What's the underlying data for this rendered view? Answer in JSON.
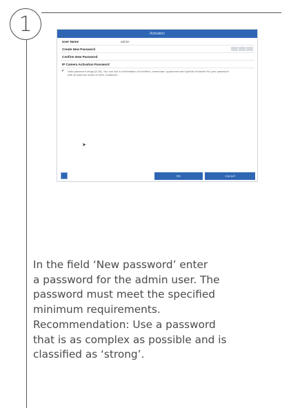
{
  "step": {
    "number": "1"
  },
  "screenshot": {
    "title": "Activation",
    "fields": [
      {
        "label": "User Name",
        "value": "admin"
      },
      {
        "label": "Create New Password",
        "value": ""
      },
      {
        "label": "Confirm New Password",
        "value": ""
      },
      {
        "label": "IP Camera Activation Password",
        "value": ""
      }
    ],
    "hint": "Valid password range [8-16]. You can use a combination of numbers, lowercase, uppercase and special character for your password with at least two kinds of them contained.",
    "buttons": {
      "ok": "OK",
      "cancel": "Cancel"
    },
    "colors": {
      "accent": "#2e66b4"
    }
  },
  "instructions": {
    "lines": [
      "In the field ‘New password’ enter",
      "a password for the admin user. The",
      "password must meet the specified",
      "minimum requirements.",
      "Recommendation: Use a password",
      "that is as complex as possible and is",
      "classified as ‘strong’."
    ]
  }
}
